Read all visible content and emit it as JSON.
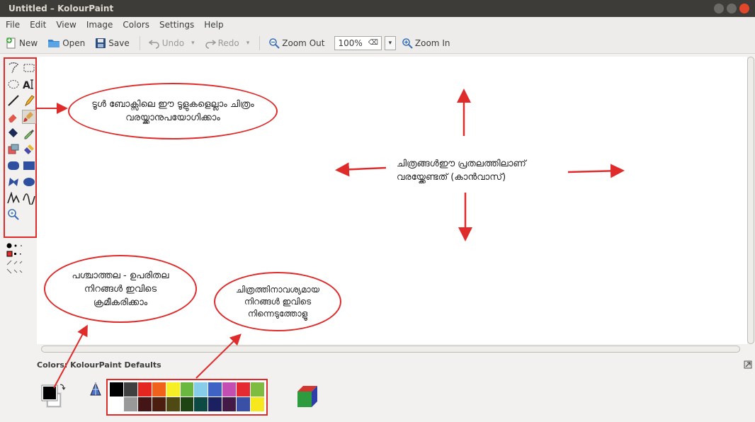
{
  "window": {
    "title": "Untitled – KolourPaint"
  },
  "menu": [
    "File",
    "Edit",
    "View",
    "Image",
    "Colors",
    "Settings",
    "Help"
  ],
  "toolbar": {
    "new": "New",
    "open": "Open",
    "save": "Save",
    "undo": "Undo",
    "redo": "Redo",
    "zoom_out": "Zoom Out",
    "zoom_value": "100%",
    "zoom_in": "Zoom In"
  },
  "palette": {
    "title": "Colors: KolourPaint Defaults",
    "row1": [
      "#000000",
      "#404040",
      "#e52520",
      "#f0621b",
      "#f7ef25",
      "#6ab840",
      "#87cde9",
      "#3f63c5",
      "#c34fb3",
      "#e52a31",
      "#7dbb41"
    ],
    "row2": [
      "#ffffff",
      "#999999",
      "#441516",
      "#4b1e10",
      "#4f4a13",
      "#1f4414",
      "#0e4a44",
      "#1b2060",
      "#441a47",
      "#3a4fa6",
      "#f7e81e"
    ]
  },
  "annotations": {
    "toolbox_note": "ടൂൾ ബോക്സിലെ ഈ ടൂളുകളെല്ലാം ചിത്രം വരയ്ക്കാനുപയോഗിക്കാം",
    "canvas_note": "ചിത്രങ്ങൾഈ പ്രതലത്തിലാണ് വരയ്ക്കേണ്ടത് (കാൻവാസ്)",
    "fgbg_note": "പശ്ചാത്തല - ഉപരിതല നിറങ്ങൾ ഇവിടെ ക്രമീകരിക്കാം",
    "palette_note": "ചിത്രത്തിനാവശ്യമായ നിറങ്ങൾ ഇവിടെ നിന്നെടുത്തോളൂ"
  },
  "colors": {
    "annotation_red": "#e02b2b",
    "titlebar": "#3d3c38",
    "close_button": "#e2462b"
  }
}
